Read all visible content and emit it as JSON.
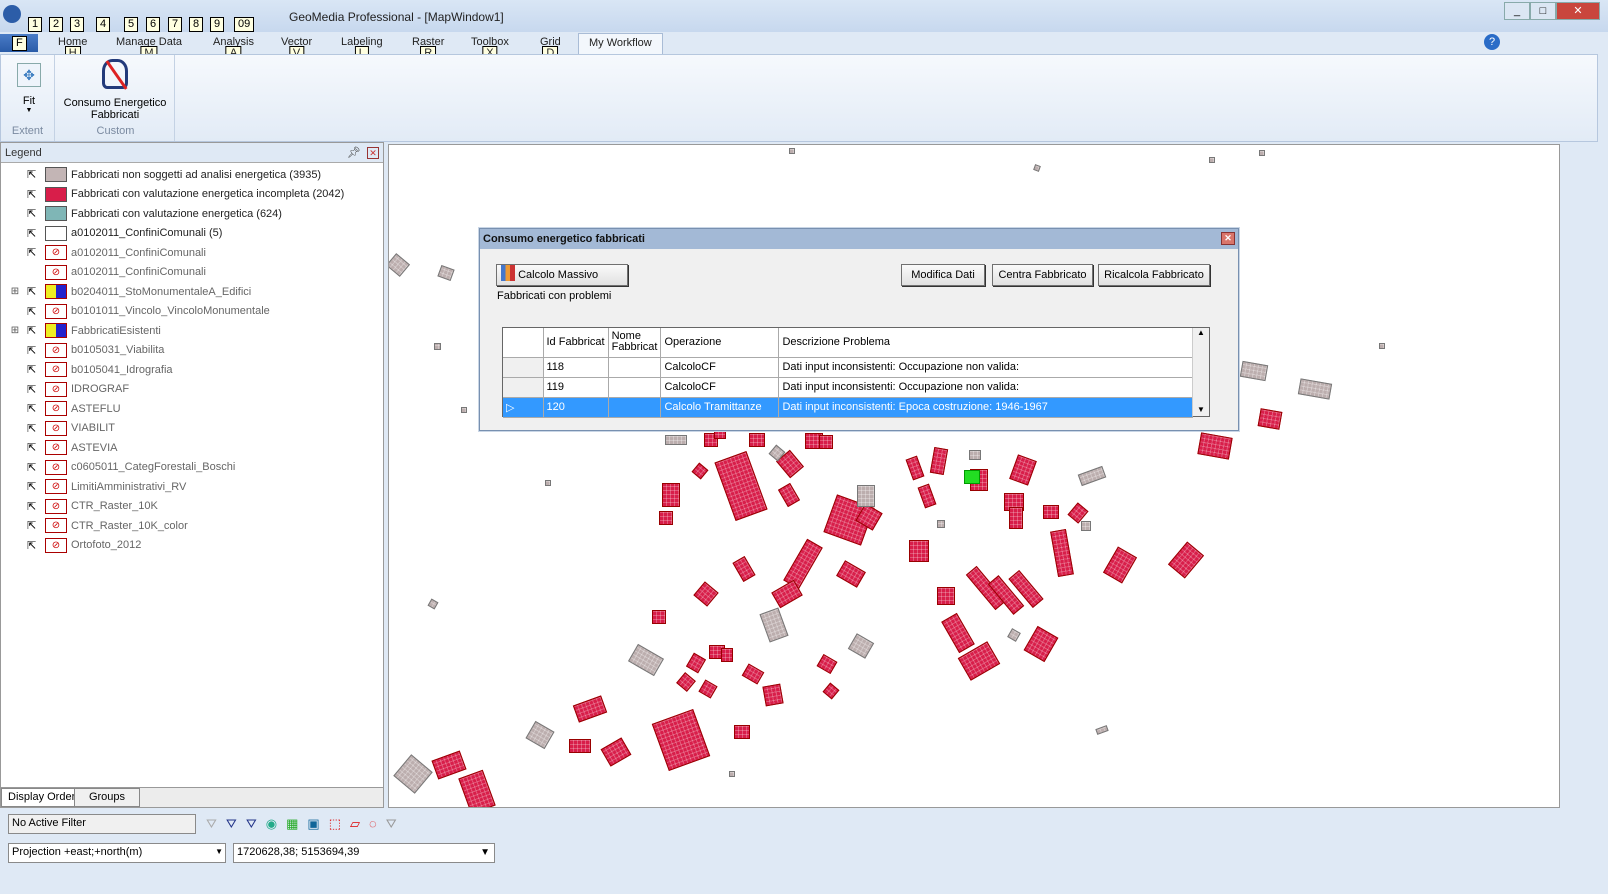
{
  "window": {
    "title": "GeoMedia Professional - [MapWindow1]",
    "controls": [
      "_",
      "□",
      "✕"
    ]
  },
  "qat_keys": [
    "1",
    "2",
    "3",
    "4",
    "5",
    "6",
    "7",
    "8",
    "9",
    "09"
  ],
  "ribbon_tabs": [
    {
      "label": "Home",
      "key": "H"
    },
    {
      "label": "Manage Data",
      "key": "M"
    },
    {
      "label": "Analysis",
      "key": "A"
    },
    {
      "label": "Vector",
      "key": "V"
    },
    {
      "label": "Labeling",
      "key": "L"
    },
    {
      "label": "Raster",
      "key": "R"
    },
    {
      "label": "Toolbox",
      "key": "X"
    },
    {
      "label": "Grid",
      "key": "D"
    },
    {
      "label": "My Workflow",
      "key": ""
    }
  ],
  "file_key": "F",
  "ribbon": {
    "fit_label": "Fit",
    "extent_group": "Extent",
    "consumo_label_1": "Consumo Energetico",
    "consumo_label_2": "Fabbricati",
    "custom_group": "Custom"
  },
  "legend": {
    "title": "Legend",
    "items": [
      {
        "label": "Fabbricati non soggetti ad analisi energetica (3935)",
        "swatch": "#c3b5b5",
        "type": "fill",
        "expand": false,
        "dim": false
      },
      {
        "label": "Fabbricati con valutazione energetica incompleta (2042)",
        "swatch": "#d81e4a",
        "type": "fill",
        "expand": false,
        "dim": false
      },
      {
        "label": "Fabbricati con valutazione energetica (624)",
        "swatch": "#7fb6b6",
        "type": "fill",
        "expand": false,
        "dim": false
      },
      {
        "label": "a0102011_ConfiniComunali (5)",
        "swatch": "#ffffff",
        "type": "fill",
        "expand": false,
        "dim": false
      },
      {
        "label": "a0102011_ConfiniComunali",
        "type": "icon",
        "expand": false,
        "dim": true
      },
      {
        "label": "a0102011_ConfiniComunali",
        "type": "icon",
        "expand": false,
        "dim": true,
        "nocursor": true
      },
      {
        "label": "b0204011_StoMonumentaleA_Edifici",
        "type": "multi",
        "expand": true,
        "dim": true
      },
      {
        "label": "b0101011_Vincolo_VincoloMonumentale",
        "type": "icon",
        "expand": false,
        "dim": true
      },
      {
        "label": "FabbricatiEsistenti",
        "type": "multi",
        "expand": true,
        "dim": true
      },
      {
        "label": "b0105031_Viabilita",
        "type": "icon",
        "expand": false,
        "dim": true
      },
      {
        "label": "b0105041_Idrografia",
        "type": "icon",
        "expand": false,
        "dim": true
      },
      {
        "label": "IDROGRAF",
        "type": "icon",
        "expand": false,
        "dim": true
      },
      {
        "label": "ASTEFLU",
        "type": "icon",
        "expand": false,
        "dim": true
      },
      {
        "label": "VIABILIT",
        "type": "icon",
        "expand": false,
        "dim": true
      },
      {
        "label": "ASTEVIA",
        "type": "icon",
        "expand": false,
        "dim": true
      },
      {
        "label": "c0605011_CategForestali_Boschi",
        "type": "icon",
        "expand": false,
        "dim": true
      },
      {
        "label": "LimitiAmministrativi_RV",
        "type": "icon",
        "expand": false,
        "dim": true
      },
      {
        "label": "CTR_Raster_10K",
        "type": "icon",
        "expand": false,
        "dim": true
      },
      {
        "label": "CTR_Raster_10K_color",
        "type": "icon",
        "expand": false,
        "dim": true
      },
      {
        "label": "Ortofoto_2012",
        "type": "icon",
        "expand": false,
        "dim": true
      }
    ],
    "tabs": [
      "Display Order",
      "Groups"
    ]
  },
  "dialog": {
    "title": "Consumo energetico fabbricati",
    "calcolo_massivo": "Calcolo Massivo",
    "modifica": "Modifica Dati",
    "centra": "Centra Fabbricato",
    "ricalcola": "Ricalcola Fabbricato",
    "subtitle": "Fabbricati con problemi",
    "columns": [
      "Id Fabbricat",
      "Nome Fabbricat",
      "Operazione",
      "Descrizione Problema"
    ],
    "rows": [
      {
        "id": "118",
        "nome": "",
        "operazione": "CalcoloCF",
        "descrizione": "Dati input inconsistenti: Occupazione non valida:",
        "selected": false
      },
      {
        "id": "119",
        "nome": "",
        "operazione": "CalcoloCF",
        "descrizione": "Dati input inconsistenti: Occupazione non valida:",
        "selected": false
      },
      {
        "id": "120",
        "nome": "",
        "operazione": "Calcolo Tramittanze",
        "descrizione": "Dati input inconsistenti: Epoca costruzione: 1946-1967",
        "selected": true
      }
    ]
  },
  "status": {
    "filter": "No Active Filter",
    "projection": "Projection +east;+north(m)",
    "coordinates": "1720628,38; 5153694,39"
  },
  "colors": {
    "incompleta": "#d81e4a",
    "non_soggetti": "#bcaeae",
    "selected": "#22dd22",
    "accent": "#3399ff"
  }
}
